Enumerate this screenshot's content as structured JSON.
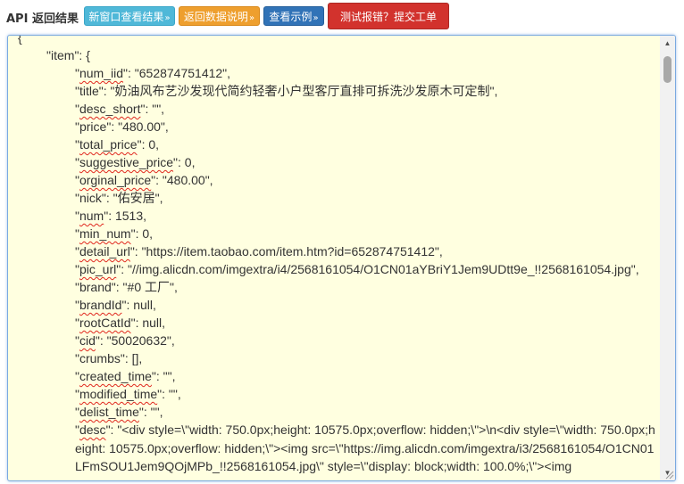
{
  "header": {
    "title": "API 返回结果",
    "buttons": {
      "new_window": "新窗口查看结果",
      "doc": "返回数据说明",
      "example": "查看示例",
      "report": "测试报错？提交工单",
      "arrow": "»"
    }
  },
  "colors": {
    "info": "#4fb8d8",
    "warning": "#ee9f2e",
    "primary": "#3173b7",
    "danger": "#d2322d",
    "result_bg": "#ffffe0"
  },
  "result": {
    "lines": [
      {
        "key": "",
        "val": "{"
      },
      {
        "key": "item",
        "val": ": {"
      },
      {
        "key": "num_iid",
        "val": ": \"652874751412\","
      },
      {
        "key": "title",
        "val": ": \"奶油风布艺沙发现代简约轻奢小户型客厅直排可拆洗沙发原木可定制\","
      },
      {
        "key": "desc_short",
        "val": ": \"\","
      },
      {
        "key": "price",
        "val": ": \"480.00\","
      },
      {
        "key": "total_price",
        "val": ": 0,"
      },
      {
        "key": "suggestive_price",
        "val": ": 0,"
      },
      {
        "key": "orginal_price",
        "val": ": \"480.00\","
      },
      {
        "key": "nick",
        "val": ": \"佑安居\","
      },
      {
        "key": "num",
        "val": ": 1513,"
      },
      {
        "key": "min_num",
        "val": ": 0,"
      },
      {
        "key": "detail_url",
        "val": ": \"https://item.taobao.com/item.htm?id=652874751412\","
      },
      {
        "key": "pic_url",
        "val": ": \"//img.alicdn.com/imgextra/i4/2568161054/O1CN01aYBriY1Jem9UDtt9e_!!2568161054.jpg\","
      },
      {
        "key": "brand",
        "val": ": \"#0 工厂\","
      },
      {
        "key": "brandId",
        "val": ": null,"
      },
      {
        "key": "rootCatId",
        "val": ": null,"
      },
      {
        "key": "cid",
        "val": ": \"50020632\","
      },
      {
        "key": "crumbs",
        "val": ": [],"
      },
      {
        "key": "created_time",
        "val": ": \"\","
      },
      {
        "key": "modified_time",
        "val": ": \"\","
      },
      {
        "key": "delist_time",
        "val": ": \"\","
      },
      {
        "key": "desc",
        "val": ": \"<div style=\\\"width: 750.0px;height: 10575.0px;overflow: hidden;\\\">\\n<div style=\\\"width: 750.0px;height: 10575.0px;overflow: hidden;\\\"><img src=\\\"https://img.alicdn.com/imgextra/i3/2568161054/O1CN01LFmSOU1Jem9QOjMPb_!!2568161054.jpg\\\" style=\\\"display: block;width: 100.0%;\\\"><img"
      }
    ]
  }
}
